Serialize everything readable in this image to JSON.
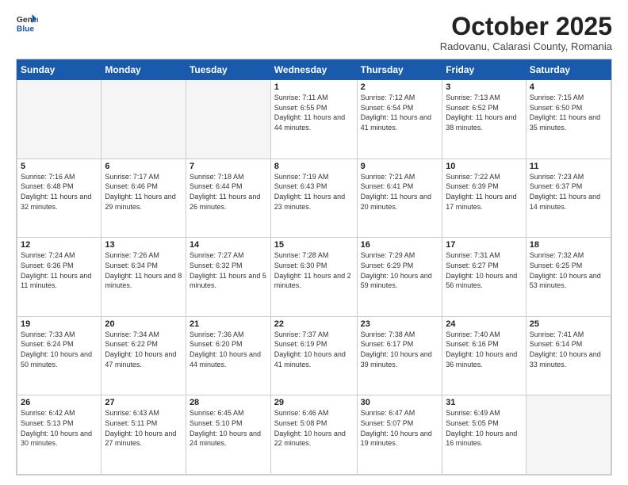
{
  "logo": {
    "general": "General",
    "blue": "Blue"
  },
  "title": "October 2025",
  "subtitle": "Radovanu, Calarasi County, Romania",
  "headers": [
    "Sunday",
    "Monday",
    "Tuesday",
    "Wednesday",
    "Thursday",
    "Friday",
    "Saturday"
  ],
  "weeks": [
    [
      {
        "day": "",
        "info": ""
      },
      {
        "day": "",
        "info": ""
      },
      {
        "day": "",
        "info": ""
      },
      {
        "day": "1",
        "info": "Sunrise: 7:11 AM\nSunset: 6:55 PM\nDaylight: 11 hours and 44 minutes."
      },
      {
        "day": "2",
        "info": "Sunrise: 7:12 AM\nSunset: 6:54 PM\nDaylight: 11 hours and 41 minutes."
      },
      {
        "day": "3",
        "info": "Sunrise: 7:13 AM\nSunset: 6:52 PM\nDaylight: 11 hours and 38 minutes."
      },
      {
        "day": "4",
        "info": "Sunrise: 7:15 AM\nSunset: 6:50 PM\nDaylight: 11 hours and 35 minutes."
      }
    ],
    [
      {
        "day": "5",
        "info": "Sunrise: 7:16 AM\nSunset: 6:48 PM\nDaylight: 11 hours and 32 minutes."
      },
      {
        "day": "6",
        "info": "Sunrise: 7:17 AM\nSunset: 6:46 PM\nDaylight: 11 hours and 29 minutes."
      },
      {
        "day": "7",
        "info": "Sunrise: 7:18 AM\nSunset: 6:44 PM\nDaylight: 11 hours and 26 minutes."
      },
      {
        "day": "8",
        "info": "Sunrise: 7:19 AM\nSunset: 6:43 PM\nDaylight: 11 hours and 23 minutes."
      },
      {
        "day": "9",
        "info": "Sunrise: 7:21 AM\nSunset: 6:41 PM\nDaylight: 11 hours and 20 minutes."
      },
      {
        "day": "10",
        "info": "Sunrise: 7:22 AM\nSunset: 6:39 PM\nDaylight: 11 hours and 17 minutes."
      },
      {
        "day": "11",
        "info": "Sunrise: 7:23 AM\nSunset: 6:37 PM\nDaylight: 11 hours and 14 minutes."
      }
    ],
    [
      {
        "day": "12",
        "info": "Sunrise: 7:24 AM\nSunset: 6:36 PM\nDaylight: 11 hours and 11 minutes."
      },
      {
        "day": "13",
        "info": "Sunrise: 7:26 AM\nSunset: 6:34 PM\nDaylight: 11 hours and 8 minutes."
      },
      {
        "day": "14",
        "info": "Sunrise: 7:27 AM\nSunset: 6:32 PM\nDaylight: 11 hours and 5 minutes."
      },
      {
        "day": "15",
        "info": "Sunrise: 7:28 AM\nSunset: 6:30 PM\nDaylight: 11 hours and 2 minutes."
      },
      {
        "day": "16",
        "info": "Sunrise: 7:29 AM\nSunset: 6:29 PM\nDaylight: 10 hours and 59 minutes."
      },
      {
        "day": "17",
        "info": "Sunrise: 7:31 AM\nSunset: 6:27 PM\nDaylight: 10 hours and 56 minutes."
      },
      {
        "day": "18",
        "info": "Sunrise: 7:32 AM\nSunset: 6:25 PM\nDaylight: 10 hours and 53 minutes."
      }
    ],
    [
      {
        "day": "19",
        "info": "Sunrise: 7:33 AM\nSunset: 6:24 PM\nDaylight: 10 hours and 50 minutes."
      },
      {
        "day": "20",
        "info": "Sunrise: 7:34 AM\nSunset: 6:22 PM\nDaylight: 10 hours and 47 minutes."
      },
      {
        "day": "21",
        "info": "Sunrise: 7:36 AM\nSunset: 6:20 PM\nDaylight: 10 hours and 44 minutes."
      },
      {
        "day": "22",
        "info": "Sunrise: 7:37 AM\nSunset: 6:19 PM\nDaylight: 10 hours and 41 minutes."
      },
      {
        "day": "23",
        "info": "Sunrise: 7:38 AM\nSunset: 6:17 PM\nDaylight: 10 hours and 39 minutes."
      },
      {
        "day": "24",
        "info": "Sunrise: 7:40 AM\nSunset: 6:16 PM\nDaylight: 10 hours and 36 minutes."
      },
      {
        "day": "25",
        "info": "Sunrise: 7:41 AM\nSunset: 6:14 PM\nDaylight: 10 hours and 33 minutes."
      }
    ],
    [
      {
        "day": "26",
        "info": "Sunrise: 6:42 AM\nSunset: 5:13 PM\nDaylight: 10 hours and 30 minutes."
      },
      {
        "day": "27",
        "info": "Sunrise: 6:43 AM\nSunset: 5:11 PM\nDaylight: 10 hours and 27 minutes."
      },
      {
        "day": "28",
        "info": "Sunrise: 6:45 AM\nSunset: 5:10 PM\nDaylight: 10 hours and 24 minutes."
      },
      {
        "day": "29",
        "info": "Sunrise: 6:46 AM\nSunset: 5:08 PM\nDaylight: 10 hours and 22 minutes."
      },
      {
        "day": "30",
        "info": "Sunrise: 6:47 AM\nSunset: 5:07 PM\nDaylight: 10 hours and 19 minutes."
      },
      {
        "day": "31",
        "info": "Sunrise: 6:49 AM\nSunset: 5:05 PM\nDaylight: 10 hours and 16 minutes."
      },
      {
        "day": "",
        "info": ""
      }
    ]
  ]
}
